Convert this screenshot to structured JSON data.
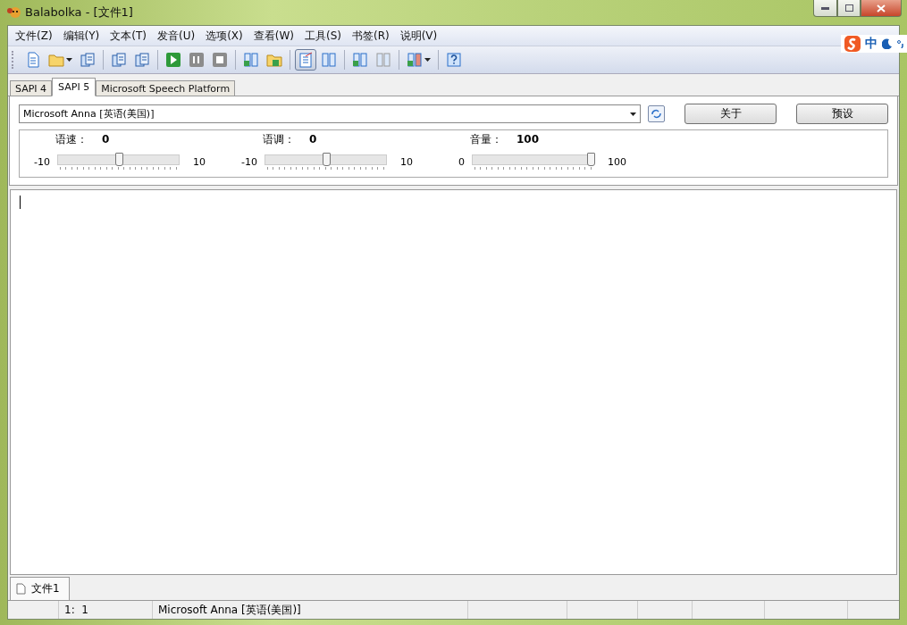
{
  "window": {
    "title": "Balabolka - [文件1]"
  },
  "menu": [
    "文件(Z)",
    "编辑(Y)",
    "文本(T)",
    "发音(U)",
    "选项(X)",
    "查看(W)",
    "工具(S)",
    "书签(R)",
    "说明(V)"
  ],
  "ime_bar": {
    "label": "中"
  },
  "toolbar": [
    [
      {
        "kind": "new",
        "pressed": false,
        "dropdown": false
      },
      {
        "kind": "open",
        "pressed": false,
        "dropdown": true
      },
      {
        "kind": "save",
        "pressed": false,
        "dropdown": false
      }
    ],
    [
      {
        "kind": "doc-audio",
        "pressed": false,
        "dropdown": false
      },
      {
        "kind": "doc-save",
        "pressed": false,
        "dropdown": false
      }
    ],
    [
      {
        "kind": "play",
        "pressed": false,
        "dropdown": false
      },
      {
        "kind": "pause",
        "pressed": false,
        "dropdown": false
      },
      {
        "kind": "stop",
        "pressed": false,
        "dropdown": false
      }
    ],
    [
      {
        "kind": "book-play",
        "pressed": false,
        "dropdown": false
      },
      {
        "kind": "folder-play",
        "pressed": false,
        "dropdown": false
      }
    ],
    [
      {
        "kind": "clipboard",
        "pressed": true,
        "dropdown": false
      },
      {
        "kind": "book",
        "pressed": false,
        "dropdown": false
      }
    ],
    [
      {
        "kind": "book-add",
        "pressed": false,
        "dropdown": false
      },
      {
        "kind": "book-grey",
        "pressed": false,
        "dropdown": false
      }
    ],
    [
      {
        "kind": "book-add-red",
        "pressed": false,
        "dropdown": true
      }
    ],
    [
      {
        "kind": "help",
        "pressed": false,
        "dropdown": false
      }
    ]
  ],
  "engine_tabs": [
    {
      "label": "SAPI 4",
      "selected": false
    },
    {
      "label": "SAPI 5",
      "selected": true
    },
    {
      "label": "Microsoft Speech Platform",
      "selected": false
    }
  ],
  "voice": {
    "value": "Microsoft Anna [英语(美国)]"
  },
  "buttons": [
    "关于",
    "预设"
  ],
  "sliders": [
    {
      "label": "语速：",
      "reading": "0",
      "min": "-10",
      "max": "10",
      "level": 0.5
    },
    {
      "label": "语调：",
      "reading": "0",
      "min": "-10",
      "max": "10",
      "level": 0.5
    },
    {
      "label": "音量：",
      "reading": "100",
      "min": "0",
      "max": "100",
      "level": 1
    }
  ],
  "doc_tabs": [
    {
      "label": "文件1",
      "selected": true
    }
  ],
  "status_bar": [
    {
      "text": "1:  1"
    },
    {
      "text": "Microsoft Anna [英语(美国)]"
    }
  ]
}
